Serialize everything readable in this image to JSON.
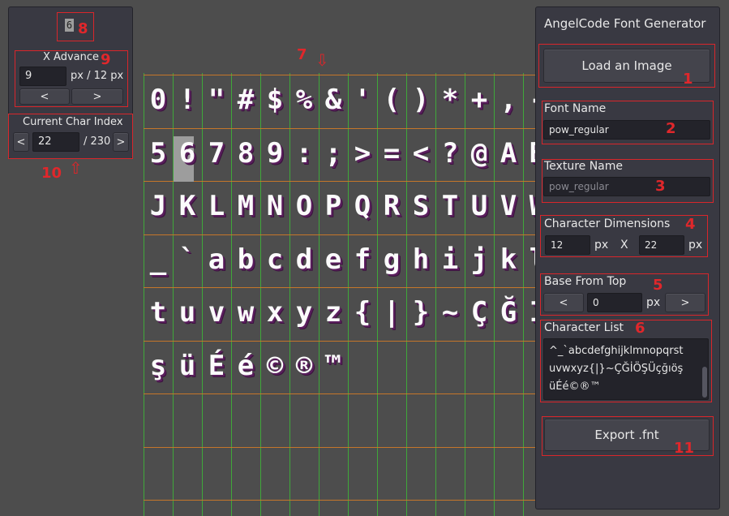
{
  "char_preview": {
    "char": "6",
    "annotation": "8"
  },
  "x_advance": {
    "title": "X Advance",
    "annotation": "9",
    "value": "9",
    "suffix": "px / 12 px",
    "prev_label": "<",
    "next_label": ">"
  },
  "char_index": {
    "title": "Current Char Index",
    "annotation": "10",
    "prev_label": "<",
    "next_label": ">",
    "value": "22",
    "total": "/ 230"
  },
  "canvas": {
    "annotation": "7",
    "rows": [
      [
        "0",
        "!",
        "\"",
        "#",
        "$",
        "%",
        "&",
        "'",
        "(",
        ")",
        "*",
        "+",
        ",",
        "-"
      ],
      [
        "5",
        "6",
        "7",
        "8",
        "9",
        ":",
        ";",
        ">",
        "=",
        "<",
        "?",
        "@",
        "A",
        "B"
      ],
      [
        "J",
        "K",
        "L",
        "M",
        "N",
        "O",
        "P",
        "Q",
        "R",
        "S",
        "T",
        "U",
        "V",
        "W"
      ],
      [
        "_",
        "`",
        "a",
        "b",
        "c",
        "d",
        "e",
        "f",
        "g",
        "h",
        "i",
        "j",
        "k",
        "l"
      ],
      [
        "t",
        "u",
        "v",
        "w",
        "x",
        "y",
        "z",
        "{",
        "|",
        "}",
        "~",
        "Ç",
        "Ğ",
        "İ"
      ],
      [
        "ş",
        "ü",
        "É",
        "é",
        "©",
        "®",
        "™"
      ]
    ]
  },
  "generator": {
    "title": "AngelCode Font Generator",
    "load_button": "Load an Image",
    "load_annotation": "1",
    "font_name_label": "Font Name",
    "font_name_value": "pow_regular",
    "font_name_annotation": "2",
    "texture_name_label": "Texture Name",
    "texture_name_placeholder": "pow_regular",
    "texture_name_annotation": "3",
    "dimensions_label": "Character Dimensions",
    "dimensions_annotation": "4",
    "dim_width": "12",
    "dim_px1": "px",
    "dim_x": "X",
    "dim_height": "22",
    "dim_px2": "px",
    "base_label": "Base From Top",
    "base_annotation": "5",
    "base_prev": "<",
    "base_value": "0",
    "base_px": "px",
    "base_next": ">",
    "charlist_label": "Character List",
    "charlist_annotation": "6",
    "charlist_lines": [
      "^_`abcdefghijklmnopqrst",
      "uvwxyz{|}~ÇĞİÖŞÜçğıöş",
      "üÉé©®™"
    ],
    "export_button": "Export .fnt",
    "export_annotation": "11"
  }
}
